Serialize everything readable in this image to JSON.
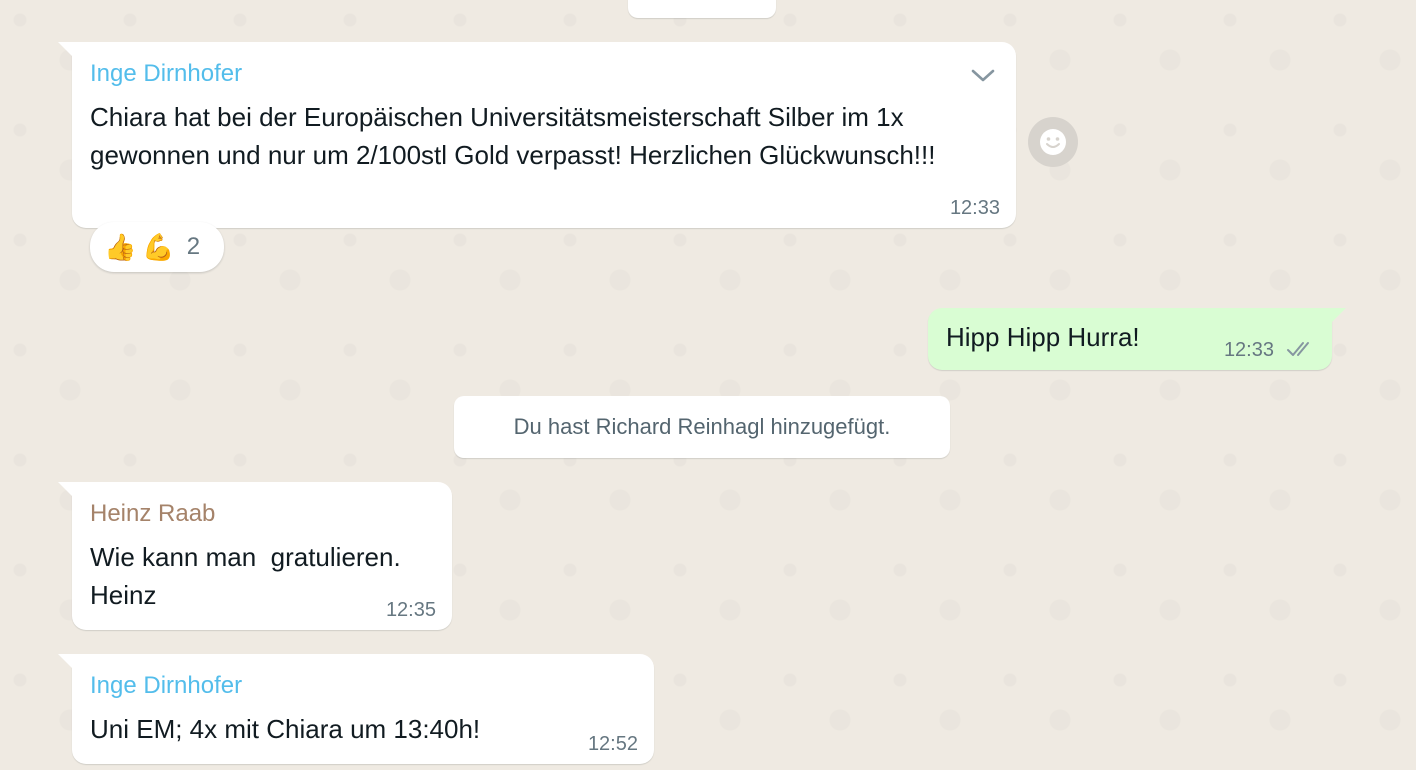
{
  "messages": [
    {
      "sender": "Inge Dirnhofer",
      "sender_color": "#53bdeb",
      "text": "Chiara hat bei der Europäischen Universitätsmeisterschaft Silber im 1x gewonnen und nur um 2/100stl Gold verpasst! Herzlichen Glückwunsch!!!",
      "time": "12:33",
      "reactions": {
        "emojis": [
          "👍",
          "💪"
        ],
        "count": "2"
      }
    },
    {
      "text": "Hipp Hipp Hurra!",
      "time": "12:33",
      "outgoing": true,
      "status_icon": "double-check-icon"
    },
    {
      "system": "Du hast Richard Reinhagl hinzugefügt."
    },
    {
      "sender": "Heinz Raab",
      "sender_color": "#a5836a",
      "text": "Wie kann man  gratulieren.\nHeinz",
      "time": "12:35"
    },
    {
      "sender": "Inge Dirnhofer",
      "sender_color": "#53bdeb",
      "text": "Uni EM; 4x mit Chiara um 13:40h!",
      "time": "12:52"
    }
  ],
  "colors": {
    "background": "#efeae2",
    "incoming_bubble": "#ffffff",
    "outgoing_bubble": "#d9fdd3",
    "timestamp": "#667781"
  }
}
